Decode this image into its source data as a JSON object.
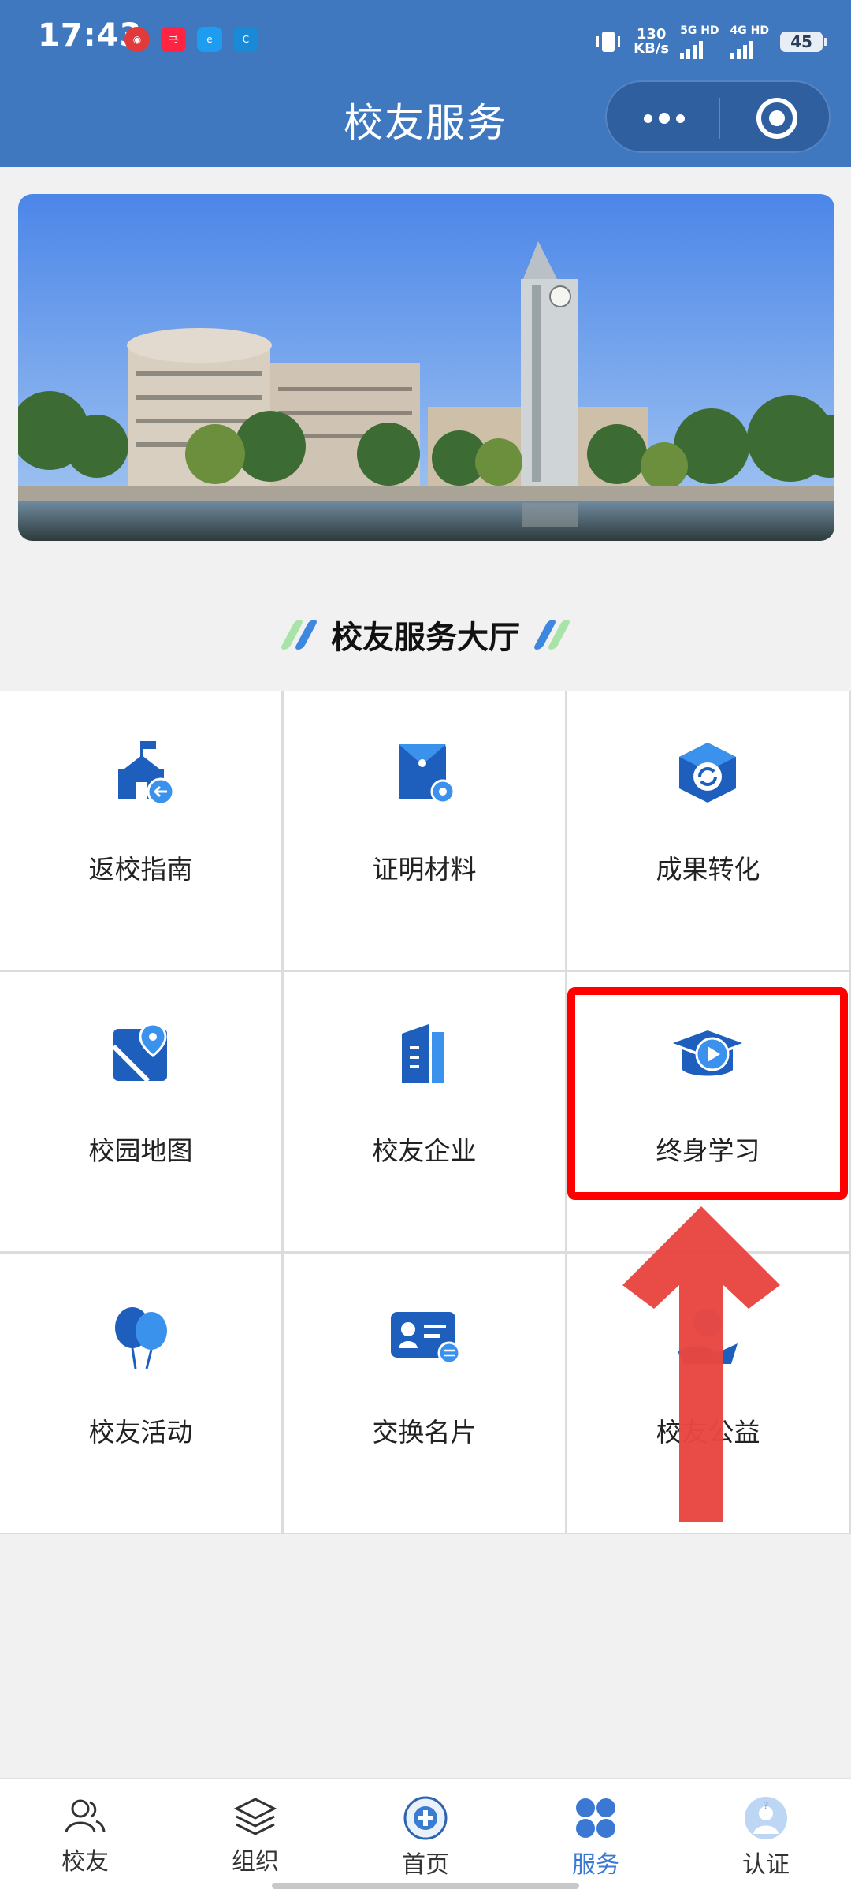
{
  "status_bar": {
    "time": "17:43",
    "net_speed_value": "130",
    "net_speed_unit": "KB/s",
    "sim1": "5G HD",
    "sim2": "4G HD",
    "battery": "45",
    "app_icons": [
      "netease-music-icon",
      "xiaohongshu-icon",
      "eleme-icon",
      "app-c-icon"
    ]
  },
  "header": {
    "title": "校友服务",
    "more_icon": "more-dots-icon",
    "close_icon": "target-circle-icon",
    "background": "#3f78bf"
  },
  "banner": {
    "icon": "campus-photo"
  },
  "section": {
    "title": "校友服务大厅"
  },
  "services": [
    {
      "label": "返校指南",
      "icon": "school-return-icon"
    },
    {
      "label": "证明材料",
      "icon": "document-gear-icon"
    },
    {
      "label": "成果转化",
      "icon": "cube-refresh-icon"
    },
    {
      "label": "校园地图",
      "icon": "map-pin-icon"
    },
    {
      "label": "校友企业",
      "icon": "building-icon"
    },
    {
      "label": "终身学习",
      "icon": "graduation-play-icon"
    },
    {
      "label": "校友活动",
      "icon": "balloons-icon"
    },
    {
      "label": "交换名片",
      "icon": "business-card-icon"
    },
    {
      "label": "校友公益",
      "icon": "charity-hand-icon"
    }
  ],
  "tabbar": [
    {
      "label": "校友",
      "icon": "people-icon",
      "active": false
    },
    {
      "label": "组织",
      "icon": "layers-icon",
      "active": false
    },
    {
      "label": "首页",
      "icon": "school-emblem-icon",
      "active": false
    },
    {
      "label": "服务",
      "icon": "four-dots-icon",
      "active": true
    },
    {
      "label": "认证",
      "icon": "avatar-question-icon",
      "active": false
    }
  ],
  "colors": {
    "accent": "#3a78d4",
    "icon_blue": "#1e5fbd",
    "highlight": "#ff0000",
    "arrow": "#e84640"
  }
}
